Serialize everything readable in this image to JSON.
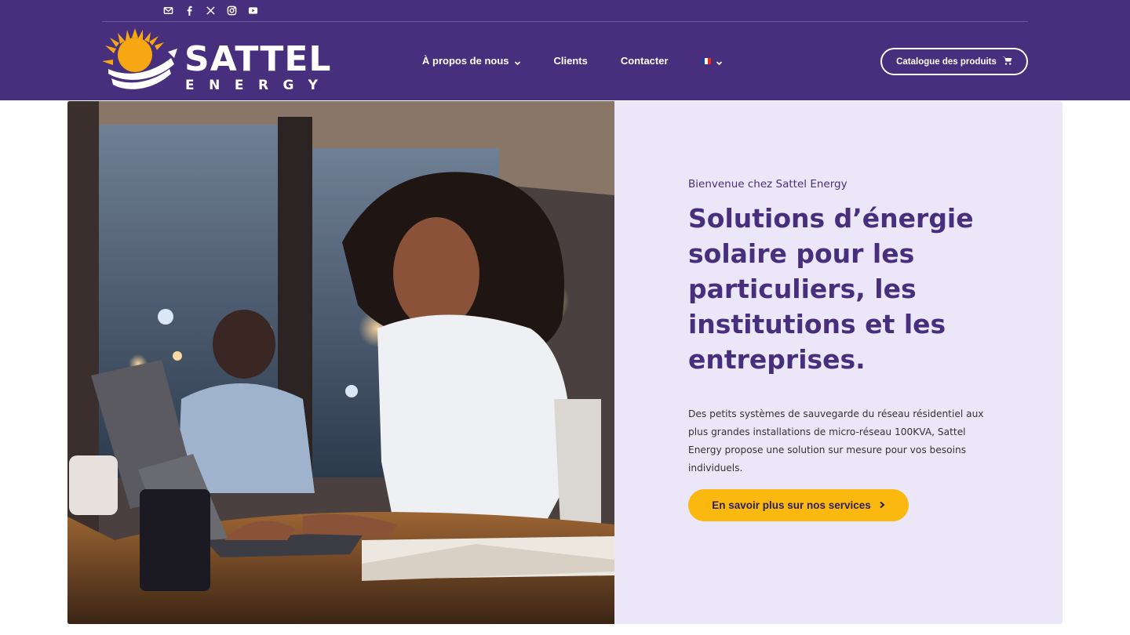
{
  "header": {
    "social_icons": [
      "mail-icon",
      "facebook-icon",
      "x-icon",
      "instagram-icon",
      "youtube-icon"
    ],
    "logo": {
      "word": "SATTEL",
      "sub": "ENERGY"
    },
    "nav": [
      {
        "label": "À propos de nous",
        "has_dropdown": true
      },
      {
        "label": "Clients",
        "has_dropdown": false
      },
      {
        "label": "Contacter",
        "has_dropdown": false
      }
    ],
    "language": {
      "icon": "france-flag-icon",
      "has_dropdown": true
    },
    "catalog_label": "Catalogue des produits",
    "catalog_icon": "cart-icon"
  },
  "hero": {
    "kicker": "Bienvenue chez Sattel Energy",
    "headline": "Solutions d’énergie solaire pour les particuliers, les institutions et les entreprises.",
    "description": "Des petits systèmes de sauvegarde du réseau résidentiel aux plus grandes installations de micro-réseau 100KVA, Sattel Energy propose une solution sur mesure pour vos besoins individuels.",
    "cta_label": "En savoir plus sur nos services"
  },
  "colors": {
    "brand_purple": "#472f7d",
    "panel_lavender": "#ece6f9",
    "cta_yellow": "#fbb80f",
    "sun_orange": "#f7a712"
  }
}
